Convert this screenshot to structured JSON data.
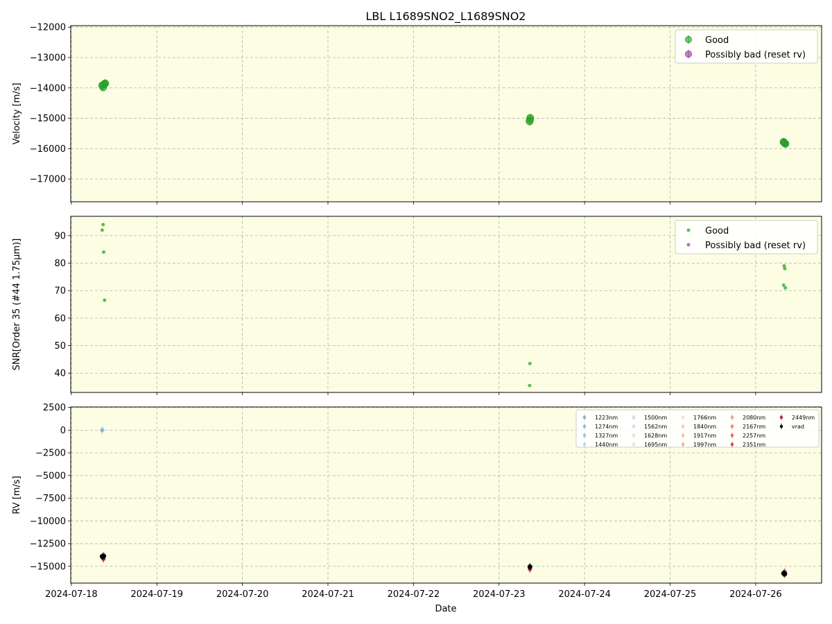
{
  "title": "LBL L1689SNO2_L1689SNO2",
  "colors": {
    "panel_bg": "#fdfde3",
    "good": "#2ca02c",
    "bad": "#9e3d9e",
    "grid": "#b0b0b0",
    "vrad": "#000000"
  },
  "x_axis": {
    "label": "Date",
    "range": [
      "2024-07-17T23:50",
      "2024-07-26T18:30"
    ],
    "ticks": [
      "2024-07-18",
      "2024-07-19",
      "2024-07-20",
      "2024-07-21",
      "2024-07-22",
      "2024-07-23",
      "2024-07-24",
      "2024-07-25",
      "2024-07-26"
    ]
  },
  "chart_data": [
    {
      "type": "scatter",
      "panel": "velocity",
      "ylabel": "Velocity [m/s]",
      "ylim": [
        -17750,
        -11950
      ],
      "yticks": [
        -12000,
        -13000,
        -14000,
        -15000,
        -16000,
        -17000
      ],
      "grid": true,
      "legend": {
        "placement": "top-right",
        "entries": [
          "Good",
          "Possibly bad (reset rv)"
        ]
      },
      "series": [
        {
          "name": "Good",
          "x": [
            "2024-07-18T08:40",
            "2024-07-18T08:55",
            "2024-07-18T09:05",
            "2024-07-18T09:20",
            "2024-07-18T09:30",
            "2024-07-23T08:35",
            "2024-07-23T08:40",
            "2024-07-23T08:45",
            "2024-07-26T07:50",
            "2024-07-26T08:00",
            "2024-07-26T08:10",
            "2024-07-26T08:20"
          ],
          "y": [
            -13920,
            -13980,
            -13900,
            -13870,
            -13850,
            -15100,
            -15050,
            -14990,
            -15780,
            -15800,
            -15820,
            -15840
          ]
        },
        {
          "name": "Possibly bad (reset rv)",
          "x": [],
          "y": []
        }
      ]
    },
    {
      "type": "scatter",
      "panel": "snr",
      "ylabel": "SNR[Order 35 (#44 1.75μm)]",
      "ylim": [
        33,
        97
      ],
      "yticks": [
        40,
        50,
        60,
        70,
        80,
        90
      ],
      "grid": true,
      "legend": {
        "placement": "top-right",
        "entries": [
          "Good",
          "Possibly bad (reset rv)"
        ]
      },
      "series": [
        {
          "name": "Good",
          "x": [
            "2024-07-18T08:40",
            "2024-07-18T08:55",
            "2024-07-18T09:05",
            "2024-07-18T09:20",
            "2024-07-23T08:35",
            "2024-07-23T08:40",
            "2024-07-26T07:50",
            "2024-07-26T08:00",
            "2024-07-26T08:10",
            "2024-07-26T08:20"
          ],
          "y": [
            92,
            94,
            84,
            66.5,
            35.5,
            43.5,
            72,
            79,
            78,
            71
          ]
        },
        {
          "name": "Possibly bad (reset rv)",
          "x": [],
          "y": []
        }
      ]
    },
    {
      "type": "scatter",
      "panel": "rv",
      "ylabel": "RV [m/s]",
      "ylim": [
        -16850,
        2550
      ],
      "yticks": [
        2500,
        0,
        -2500,
        -5000,
        -7500,
        -10000,
        -12500,
        -15000
      ],
      "grid": true,
      "legend": {
        "placement": "top-right",
        "columns": 5
      },
      "series": [
        {
          "name": "1223nm",
          "color": "#7ea6e6",
          "x": [
            "2024-07-18T08:40",
            "2024-07-18T09:05",
            "2024-07-23T08:40",
            "2024-07-26T08:00"
          ],
          "y": [
            0,
            -13850,
            -15050,
            -15700
          ]
        },
        {
          "name": "1274nm",
          "color": "#8cb1ee",
          "x": [
            "2024-07-18T08:55",
            "2024-07-23T08:40",
            "2024-07-26T08:10"
          ],
          "y": [
            -13900,
            -15100,
            -15750
          ]
        },
        {
          "name": "1327nm",
          "color": "#9bbcf2",
          "x": [
            "2024-07-18T09:00",
            "2024-07-23T08:40",
            "2024-07-26T08:10"
          ],
          "y": [
            -13800,
            -15000,
            -15700
          ]
        },
        {
          "name": "1440nm",
          "color": "#b6cff7",
          "x": [
            "2024-07-18T09:10",
            "2024-07-23T08:40",
            "2024-07-26T08:10"
          ],
          "y": [
            -13750,
            -15100,
            -15800
          ]
        },
        {
          "name": "1500nm",
          "color": "#c4d7f5",
          "x": [
            "2024-07-18T09:00",
            "2024-07-23T08:40"
          ],
          "y": [
            -13900,
            -15150
          ]
        },
        {
          "name": "1562nm",
          "color": "#cfddf2",
          "x": [
            "2024-07-18T09:00",
            "2024-07-23T08:40"
          ],
          "y": [
            -13950,
            -15100
          ]
        },
        {
          "name": "1628nm",
          "color": "#d8e0ea",
          "x": [
            "2024-07-18T09:00",
            "2024-07-26T08:10"
          ],
          "y": [
            -13900,
            -15800
          ]
        },
        {
          "name": "1695nm",
          "color": "#e0e2e6",
          "x": [
            "2024-07-18T09:00",
            "2024-07-26T08:10"
          ],
          "y": [
            -13950,
            -15750
          ]
        },
        {
          "name": "1766nm",
          "color": "#f0dccb",
          "x": [
            "2024-07-18T09:00",
            "2024-07-23T08:40"
          ],
          "y": [
            -14000,
            -15200
          ]
        },
        {
          "name": "1840nm",
          "color": "#f3cfb4",
          "x": [
            "2024-07-18T09:00",
            "2024-07-26T08:10"
          ],
          "y": [
            -14050,
            -15850
          ]
        },
        {
          "name": "1917nm",
          "color": "#f4c3a0",
          "x": [
            "2024-07-18T09:00",
            "2024-07-23T08:40"
          ],
          "y": [
            -14000,
            -15250
          ]
        },
        {
          "name": "1997nm",
          "color": "#f2b38e",
          "x": [
            "2024-07-18T09:00",
            "2024-07-26T08:10"
          ],
          "y": [
            -14100,
            -15900
          ]
        },
        {
          "name": "2080nm",
          "color": "#ef9f7e",
          "x": [
            "2024-07-18T09:00",
            "2024-07-23T08:40"
          ],
          "y": [
            -14050,
            -15300
          ]
        },
        {
          "name": "2167nm",
          "color": "#e8836a",
          "x": [
            "2024-07-18T09:00",
            "2024-07-26T08:10"
          ],
          "y": [
            -14150,
            -15950
          ]
        },
        {
          "name": "2257nm",
          "color": "#df6658",
          "x": [
            "2024-07-18T09:00",
            "2024-07-23T08:40"
          ],
          "y": [
            -14100,
            -15350
          ]
        },
        {
          "name": "2351nm",
          "color": "#cf4448",
          "x": [
            "2024-07-18T09:00",
            "2024-07-26T08:10"
          ],
          "y": [
            -14200,
            -15600
          ]
        },
        {
          "name": "2449nm",
          "color": "#a8243a",
          "x": [
            "2024-07-18T09:00",
            "2024-07-23T08:40"
          ],
          "y": [
            -14150,
            -15250
          ]
        },
        {
          "name": "vrad",
          "color": "#000000",
          "x": [
            "2024-07-18T08:40",
            "2024-07-18T09:05",
            "2024-07-23T08:40",
            "2024-07-26T07:50",
            "2024-07-26T08:10"
          ],
          "y": [
            -13920,
            -13880,
            -15050,
            -15780,
            -15820
          ]
        }
      ]
    }
  ]
}
